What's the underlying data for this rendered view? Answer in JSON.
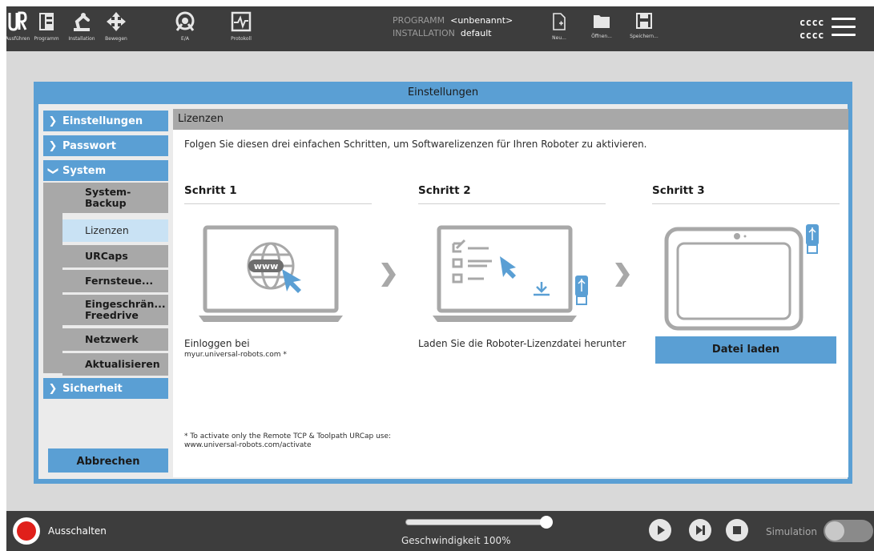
{
  "topbar": {
    "nav": [
      {
        "label": "Ausführen",
        "icon": "ur-logo-icon"
      },
      {
        "label": "Programm",
        "icon": "program-icon"
      },
      {
        "label": "Installation",
        "icon": "robot-arm-icon"
      },
      {
        "label": "Bewegen",
        "icon": "move-arrows-icon"
      },
      {
        "label": "E/A",
        "icon": "io-icon"
      },
      {
        "label": "Protokoll",
        "icon": "log-icon"
      }
    ],
    "program_key": "PROGRAMM",
    "program_value": "<unbenannt>",
    "installation_key": "INSTALLATION",
    "installation_value": "default",
    "file": {
      "new": "Neu...",
      "open": "Öffnen...",
      "save": "Speichern..."
    },
    "user_line1": "cccc",
    "user_line2": "cccc"
  },
  "dialog": {
    "title": "Einstellungen",
    "menu": {
      "settings": "Einstellungen",
      "password": "Passwort",
      "system": "System",
      "system_backup": "System-Backup",
      "licenses": "Lizenzen",
      "urcaps": "URCaps",
      "remote": "Fernsteue...",
      "restricted_freedrive": "Eingeschrän... Freedrive",
      "network": "Netzwerk",
      "update": "Aktualisieren",
      "safety": "Sicherheit"
    },
    "cancel": "Abbrechen"
  },
  "panel": {
    "header": "Lizenzen",
    "intro": "Folgen Sie diesen drei einfachen Schritten, um Softwarelizenzen für Ihren Roboter zu aktivieren.",
    "step1_title": "Schritt 1",
    "step1_text": "Einloggen bei",
    "step1_url": "myur.universal-robots.com *",
    "step2_title": "Schritt 2",
    "step2_text": "Laden Sie die Roboter-Lizenzdatei herunter",
    "step3_title": "Schritt 3",
    "load_button": "Datei laden",
    "www_label": "www",
    "footnote1": "* To activate only the Remote TCP & Toolpath URCap use:",
    "footnote2": "www.universal-robots.com/activate"
  },
  "bottombar": {
    "power": "Ausschalten",
    "speed": "Geschwindigkeit 100%",
    "speed_value_percent": 100,
    "simulation": "Simulation",
    "simulation_on": false
  },
  "colors": {
    "accent": "#5a9fd4",
    "bar": "#3d3d3d",
    "menu_gray": "#a8a8a8",
    "active": "#c9e2f4",
    "power_red": "#e0201b"
  }
}
